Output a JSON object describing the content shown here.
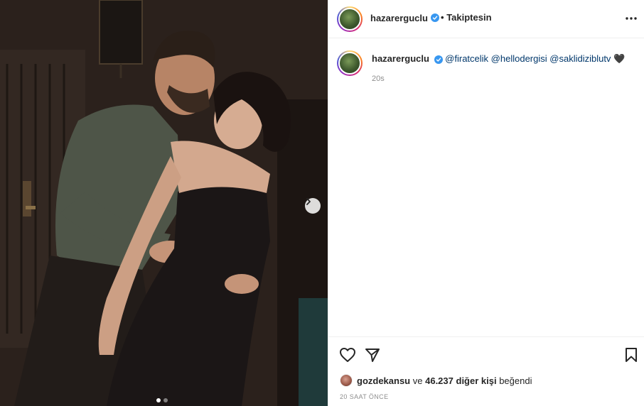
{
  "photo": {
    "description_icon": "photo-carousel",
    "next_icon": "chevron-right-icon",
    "carousel": {
      "total": 2,
      "current": 1
    }
  },
  "header": {
    "username": "hazarerguclu",
    "separator": "•",
    "follow_state": "Takiptesin",
    "verified_icon": "verified-badge-icon",
    "more_icon": "more-horizontal-icon"
  },
  "caption": {
    "username": "hazarerguclu",
    "mentions": [
      "@firatcelik",
      "@hellodergisi",
      "@saklidiziblutv"
    ],
    "emoji": "🖤",
    "time": "20s"
  },
  "actions": {
    "like_icon": "heart-icon",
    "share_icon": "send-icon",
    "save_icon": "bookmark-icon"
  },
  "likes": {
    "first_liker": "gozdekansu",
    "connector": "ve",
    "count": "46.237",
    "others_text": "diğer kişi",
    "suffix": "beğendi"
  },
  "post_time": "20 SAAT ÖNCE",
  "colors": {
    "accent_link": "#00376b",
    "verified_blue": "#3897f0",
    "muted": "#8e8e8e",
    "text": "#262626",
    "border": "#efefef"
  }
}
